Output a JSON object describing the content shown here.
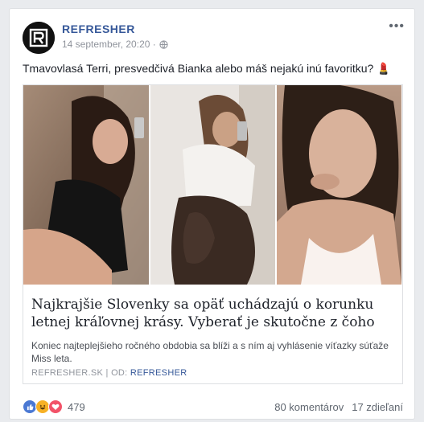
{
  "post": {
    "page_name": "REFRESHER",
    "timestamp": "14 september, 20:20 ·",
    "privacy_icon": "globe-icon",
    "more_icon": "ellipsis-icon",
    "status_text": "Tmavovlasá Terri, presvedčivá Bianka alebo máš nejakú inú favoritku? 💄"
  },
  "link": {
    "title": "Najkrajšie Slovenky sa opäť uchádzajú o korunku letnej kráľovnej krásy. Vyberať je skutočne z čoho",
    "description": "Koniec najteplejšieho ročného obdobia sa blíži a s ním aj vyhlásenie víťazky súťaže Miss leta.",
    "domain": "REFRESHER.SK",
    "separator": "|",
    "by_label": "OD:",
    "by": "REFRESHER"
  },
  "footer": {
    "reaction_icons": [
      "like-icon",
      "haha-icon",
      "love-icon"
    ],
    "reaction_count": "479",
    "comments": "80 komentárov",
    "shares": "17 zdieľaní"
  },
  "colors": {
    "link_blue": "#365899",
    "like_blue": "#4a78d3",
    "haha_yellow": "#f7b125",
    "love_red": "#f25268"
  }
}
